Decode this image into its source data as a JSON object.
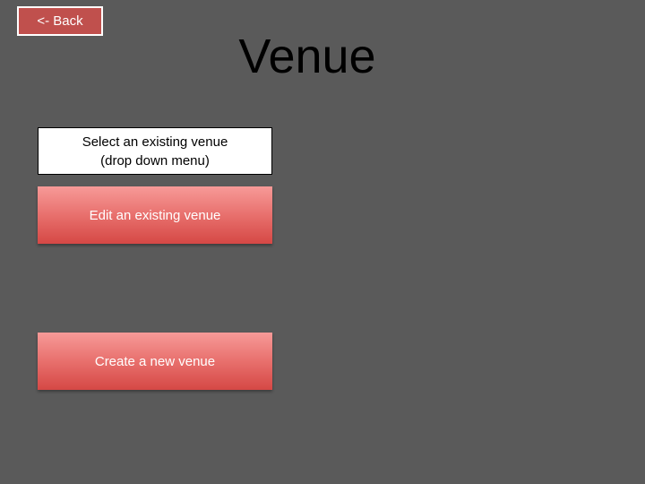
{
  "header": {
    "back_label": "<- Back",
    "title": "Venue"
  },
  "venue_select": {
    "line1": "Select an existing venue",
    "line2": "(drop down menu)"
  },
  "actions": {
    "edit_label": "Edit an existing venue",
    "create_label": "Create a new venue"
  },
  "colors": {
    "background": "#5a5a5a",
    "back_button": "#c0504d",
    "action_button": "#e8706d"
  }
}
